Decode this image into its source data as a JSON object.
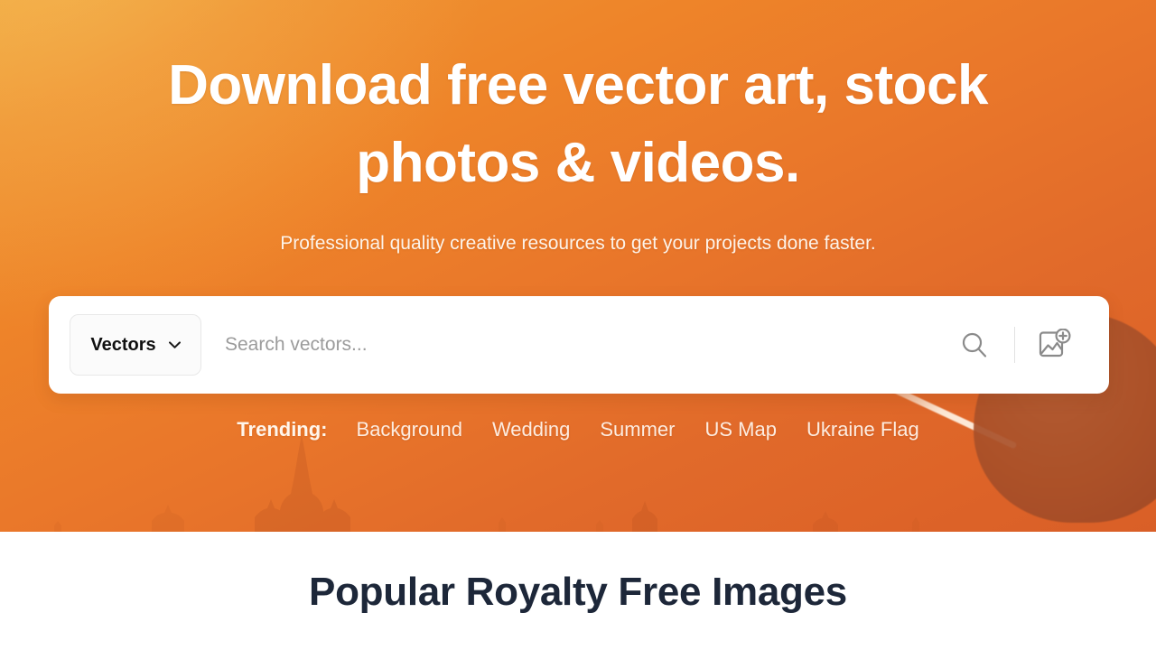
{
  "hero": {
    "title": "Download free vector art, stock photos & videos.",
    "subtitle": "Professional quality creative resources to get your projects done faster.",
    "background_color_top": "#f0a63c",
    "background_color_bottom": "#d95f27",
    "balloon_color": "#a9512a"
  },
  "search": {
    "type_selected": "Vectors",
    "placeholder": "Search vectors...",
    "value": "",
    "search_icon": "search-icon",
    "upload_icon": "image-upload-icon",
    "dropdown_icon": "chevron-down-icon"
  },
  "trending": {
    "label": "Trending:",
    "items": [
      {
        "label": "Background"
      },
      {
        "label": "Wedding"
      },
      {
        "label": "Summer"
      },
      {
        "label": "US Map"
      },
      {
        "label": "Ukraine Flag"
      }
    ]
  },
  "section": {
    "title": "Popular Royalty Free Images",
    "title_color": "#1d2739"
  }
}
